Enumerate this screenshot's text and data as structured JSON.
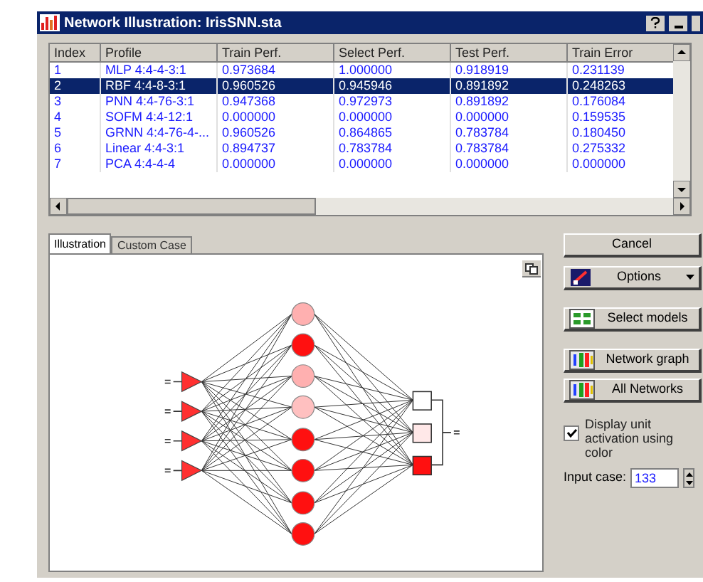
{
  "window": {
    "title": "Network Illustration: IrisSNN.sta"
  },
  "table": {
    "columns": [
      "Index",
      "Profile",
      "Train Perf.",
      "Select Perf.",
      "Test Perf.",
      "Train Error"
    ],
    "rows": [
      {
        "cells": [
          "1",
          "MLP 4:4-4-3:1",
          "0.973684",
          "1.000000",
          "0.918919",
          "0.231139"
        ],
        "selected": false
      },
      {
        "cells": [
          "2",
          "RBF 4:4-8-3:1",
          "0.960526",
          "0.945946",
          "0.891892",
          "0.248263"
        ],
        "selected": true
      },
      {
        "cells": [
          "3",
          "PNN 4:4-76-3:1",
          "0.947368",
          "0.972973",
          "0.891892",
          "0.176084"
        ],
        "selected": false
      },
      {
        "cells": [
          "4",
          "SOFM 4:4-12:1",
          "0.000000",
          "0.000000",
          "0.000000",
          "0.159535"
        ],
        "selected": false
      },
      {
        "cells": [
          "5",
          "GRNN 4:4-76-4-...",
          "0.960526",
          "0.864865",
          "0.783784",
          "0.180450"
        ],
        "selected": false
      },
      {
        "cells": [
          "6",
          "Linear 4:4-3:1",
          "0.894737",
          "0.783784",
          "0.783784",
          "0.275332"
        ],
        "selected": false
      },
      {
        "cells": [
          "7",
          "PCA 4:4-4-4",
          "0.000000",
          "0.000000",
          "0.000000",
          "0.000000"
        ],
        "selected": false
      }
    ]
  },
  "tabs": [
    {
      "label": "Illustration",
      "selected": true
    },
    {
      "label": "Custom Case",
      "selected": false
    }
  ],
  "network": {
    "inputs": [
      {
        "color": "#ff3030"
      },
      {
        "color": "#ff3030"
      },
      {
        "color": "#ff3030"
      },
      {
        "color": "#ff3030"
      }
    ],
    "hidden": [
      {
        "color": "#ffb0b0"
      },
      {
        "color": "#ff1010"
      },
      {
        "color": "#ffb0b0"
      },
      {
        "color": "#ffc0c0"
      },
      {
        "color": "#ff1010"
      },
      {
        "color": "#ff1010"
      },
      {
        "color": "#ff1010"
      },
      {
        "color": "#ff1010"
      }
    ],
    "outputs": [
      {
        "color": "#ffffff"
      },
      {
        "color": "#ffe8e8"
      },
      {
        "color": "#ff1010"
      }
    ]
  },
  "buttons": [
    {
      "label": "Cancel",
      "kind": "plain"
    },
    {
      "label": "Options",
      "kind": "dropdown"
    },
    {
      "label": "Select models",
      "kind": "models"
    },
    {
      "label": "Network graph",
      "kind": "graph"
    },
    {
      "label": "All Networks",
      "kind": "graph"
    }
  ],
  "display_colors": {
    "label": "Display unit activation using color",
    "checked": true
  },
  "input_case": {
    "label": "Input case:",
    "value": "133"
  }
}
